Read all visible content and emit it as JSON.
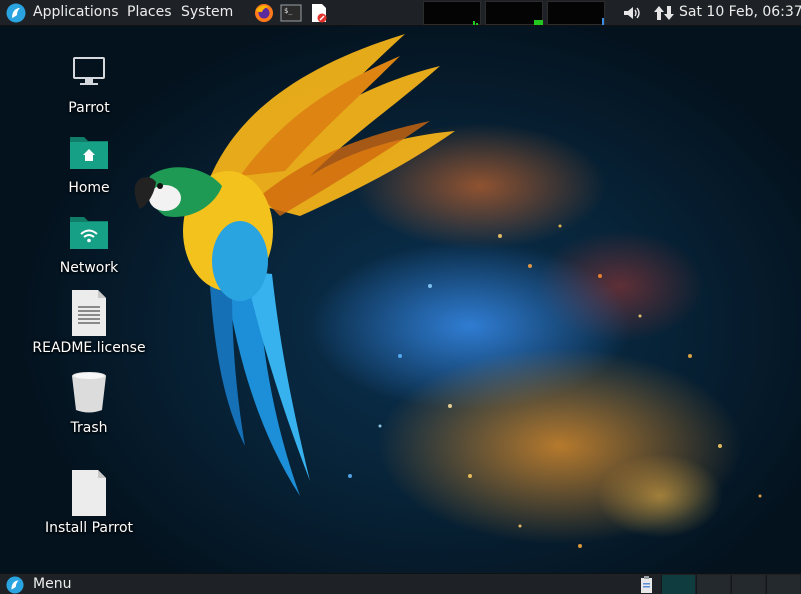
{
  "top_panel": {
    "menus": {
      "applications": "Applications",
      "places": "Places",
      "system": "System"
    },
    "launchers": [
      "firefox-icon",
      "terminal-icon",
      "text-editor-icon"
    ],
    "monitors": [
      "cpu-graph",
      "memory-graph",
      "network-graph"
    ],
    "tray": [
      "volume-icon",
      "network-activity-icon"
    ],
    "clock": "Sat 10 Feb, 06:37"
  },
  "desktop": {
    "icons": [
      {
        "label": "Parrot",
        "icon": "computer-icon"
      },
      {
        "label": "Home",
        "icon": "home-folder-icon"
      },
      {
        "label": "Network",
        "icon": "network-folder-icon"
      },
      {
        "label": "README.license",
        "icon": "text-file-icon"
      },
      {
        "label": "Trash",
        "icon": "trash-icon"
      },
      {
        "label": "Install Parrot",
        "icon": "installer-file-icon"
      }
    ]
  },
  "bottom_panel": {
    "menu_label": "Menu",
    "tray": [
      "clipboard-icon"
    ],
    "workspaces": 4,
    "active_workspace": 1
  },
  "colors": {
    "panel": "#1e2226",
    "folder_green": "#16a085",
    "parrot_blue": "#2aa4e0",
    "graph_green": "#23c81e"
  }
}
